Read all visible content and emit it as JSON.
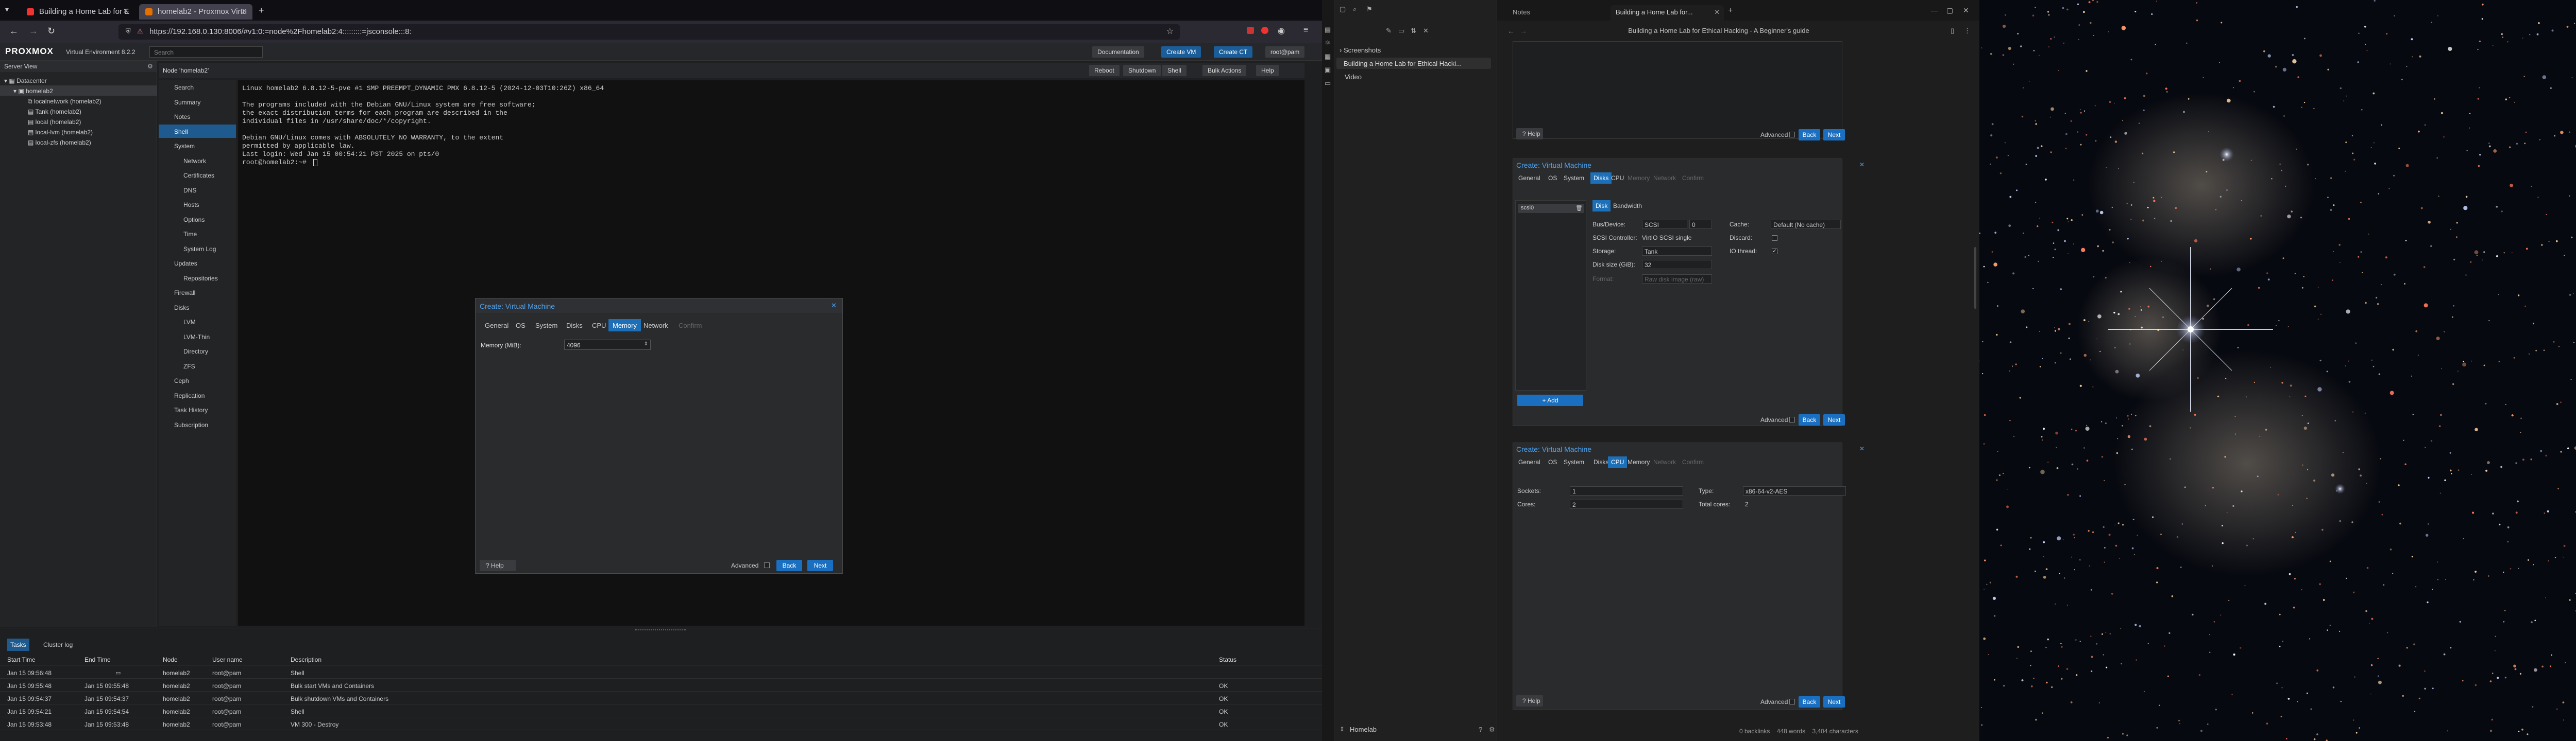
{
  "browser": {
    "tabs": [
      {
        "title": "Building a Home Lab for E"
      },
      {
        "title": "homelab2 - Proxmox Virtu"
      }
    ],
    "url": "https://192.168.0.130:8006/#v1:0:=node%2Fhomelab2:4:::::::::=jsconsole:::8:"
  },
  "pve": {
    "logo": "PROXMOX",
    "product": "Virtual Environment 8.2.2",
    "search_placeholder": "Search",
    "buttons": {
      "docs": "Documentation",
      "create_vm": "Create VM",
      "create_ct": "Create CT",
      "user": "root@pam"
    },
    "node_label": "Node 'homelab2'",
    "node_actions": [
      "Reboot",
      "Shutdown",
      "Shell",
      "Bulk Actions",
      "Help"
    ],
    "view_select": "Server View",
    "tree": [
      "Datacenter",
      "homelab2",
      "localnetwork (homelab2)",
      "Tank (homelab2)",
      "local (homelab2)",
      "local-lvm (homelab2)",
      "local-zfs (homelab2)"
    ],
    "menu": [
      {
        "label": "Search",
        "sub": false,
        "sel": false
      },
      {
        "label": "Summary",
        "sub": false,
        "sel": false
      },
      {
        "label": "Notes",
        "sub": false,
        "sel": false
      },
      {
        "label": "Shell",
        "sub": false,
        "sel": true
      },
      {
        "label": "System",
        "sub": false,
        "sel": false
      },
      {
        "label": "Network",
        "sub": true,
        "sel": false
      },
      {
        "label": "Certificates",
        "sub": true,
        "sel": false
      },
      {
        "label": "DNS",
        "sub": true,
        "sel": false
      },
      {
        "label": "Hosts",
        "sub": true,
        "sel": false
      },
      {
        "label": "Options",
        "sub": true,
        "sel": false
      },
      {
        "label": "Time",
        "sub": true,
        "sel": false
      },
      {
        "label": "System Log",
        "sub": true,
        "sel": false
      },
      {
        "label": "Updates",
        "sub": false,
        "sel": false
      },
      {
        "label": "Repositories",
        "sub": true,
        "sel": false
      },
      {
        "label": "Firewall",
        "sub": false,
        "sel": false
      },
      {
        "label": "Disks",
        "sub": false,
        "sel": false
      },
      {
        "label": "LVM",
        "sub": true,
        "sel": false
      },
      {
        "label": "LVM-Thin",
        "sub": true,
        "sel": false
      },
      {
        "label": "Directory",
        "sub": true,
        "sel": false
      },
      {
        "label": "ZFS",
        "sub": true,
        "sel": false
      },
      {
        "label": "Ceph",
        "sub": false,
        "sel": false
      },
      {
        "label": "Replication",
        "sub": false,
        "sel": false
      },
      {
        "label": "Task History",
        "sub": false,
        "sel": false
      },
      {
        "label": "Subscription",
        "sub": false,
        "sel": false
      }
    ],
    "terminal": [
      "Linux homelab2 6.8.12-5-pve #1 SMP PREEMPT_DYNAMIC PMX 6.8.12-5 (2024-12-03T10:26Z) x86_64",
      "",
      "The programs included with the Debian GNU/Linux system are free software;",
      "the exact distribution terms for each program are described in the",
      "individual files in /usr/share/doc/*/copyright.",
      "",
      "Debian GNU/Linux comes with ABSOLUTELY NO WARRANTY, to the extent",
      "permitted by applicable law.",
      "Last login: Wed Jan 15 00:54:21 PST 2025 on pts/0",
      "root@homelab2:~# "
    ],
    "dialog": {
      "title": "Create: Virtual Machine",
      "tabs": [
        "General",
        "OS",
        "System",
        "Disks",
        "CPU",
        "Memory",
        "Network",
        "Confirm"
      ],
      "memory_label": "Memory (MiB):",
      "memory_value": "4096",
      "help": "Help",
      "advanced": "Advanced",
      "back": "Back",
      "next": "Next"
    },
    "tasks": {
      "tabs": [
        "Tasks",
        "Cluster log"
      ],
      "headers": [
        "Start Time",
        "End Time",
        "Node",
        "User name",
        "Description",
        "Status"
      ],
      "rows": [
        {
          "start": "Jan 15 09:56:48",
          "end": "",
          "node": "homelab2",
          "user": "root@pam",
          "desc": "Shell",
          "status": ""
        },
        {
          "start": "Jan 15 09:55:48",
          "end": "Jan 15 09:55:48",
          "node": "homelab2",
          "user": "root@pam",
          "desc": "Bulk start VMs and Containers",
          "status": "OK"
        },
        {
          "start": "Jan 15 09:54:37",
          "end": "Jan 15 09:54:37",
          "node": "homelab2",
          "user": "root@pam",
          "desc": "Bulk shutdown VMs and Containers",
          "status": "OK"
        },
        {
          "start": "Jan 15 09:54:21",
          "end": "Jan 15 09:54:54",
          "node": "homelab2",
          "user": "root@pam",
          "desc": "Shell",
          "status": "OK"
        },
        {
          "start": "Jan 15 09:53:48",
          "end": "Jan 15 09:53:48",
          "node": "homelab2",
          "user": "root@pam",
          "desc": "VM 300 - Destroy",
          "status": "OK"
        }
      ]
    }
  },
  "obsidian": {
    "tab": "Notes",
    "note_title": "Building a Home Lab for...",
    "header_title": "Building a Home Lab for Ethical Hacking - A Beginner's guide",
    "files": [
      "Screenshots",
      "Building a Home Lab for Ethical Hacki...",
      "Video"
    ],
    "vault": "Homelab",
    "status": [
      "0 backlinks",
      "448 words",
      "3,404 characters"
    ],
    "img_top": {
      "help": "Help",
      "advanced": "Advanced",
      "back": "Back",
      "next": "Next"
    },
    "img_disks": {
      "title": "Create: Virtual Machine",
      "tabs": [
        "General",
        "OS",
        "System",
        "Disks",
        "CPU",
        "Memory",
        "Network",
        "Confirm"
      ],
      "disk_item": "scsi0",
      "subtabs": [
        "Disk",
        "Bandwidth"
      ],
      "labels": {
        "bus": "Bus/Device:",
        "ctrl": "SCSI Controller:",
        "storage": "Storage:",
        "size": "Disk size (GiB):",
        "format": "Format:",
        "cache": "Cache:",
        "discard": "Discard:",
        "iothread": "IO thread:"
      },
      "values": {
        "bus": "SCSI",
        "dev": "0",
        "ctrl": "VirtIO SCSI single",
        "storage": "Tank",
        "size": "32",
        "format": "Raw disk image (raw)",
        "cache": "Default (No cache)"
      },
      "add": "Add",
      "advanced": "Advanced",
      "back": "Back",
      "next": "Next"
    },
    "img_cpu": {
      "title": "Create: Virtual Machine",
      "tabs": [
        "General",
        "OS",
        "System",
        "Disks",
        "CPU",
        "Memory",
        "Network",
        "Confirm"
      ],
      "labels": {
        "sockets": "Sockets:",
        "cores": "Cores:",
        "type": "Type:",
        "total": "Total cores:"
      },
      "values": {
        "sockets": "1",
        "cores": "2",
        "type": "x86-64-v2-AES",
        "total": "2"
      },
      "help": "Help",
      "advanced": "Advanced",
      "back": "Back",
      "next": "Next"
    }
  }
}
